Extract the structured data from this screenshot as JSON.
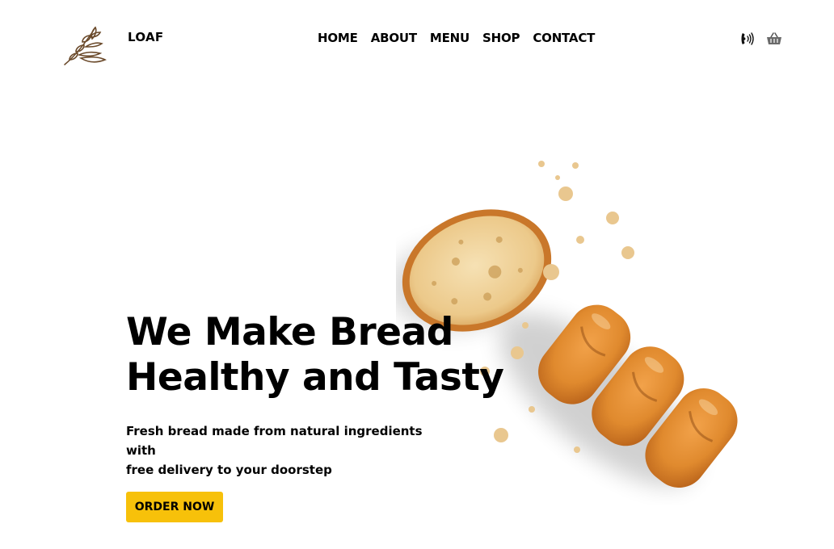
{
  "header": {
    "brand_name": "LOAF",
    "nav": [
      "HOME",
      "ABOUT",
      "MENU",
      "SHOP",
      "CONTACT"
    ],
    "icons": [
      "phone-icon",
      "cart-icon"
    ]
  },
  "hero": {
    "title_line1": "We Make Bread",
    "title_line2": "Healthy and Tasty",
    "subtitle_line1": "Fresh bread made from natural ingredients with",
    "subtitle_line2": "free delivery to your doorstep",
    "cta_label": "ORDER NOW",
    "image": "sliced-baguette-image"
  },
  "colors": {
    "accent": "#f7c10a",
    "text": "#000000",
    "background": "#ffffff",
    "logo": "#6b4a2b"
  }
}
